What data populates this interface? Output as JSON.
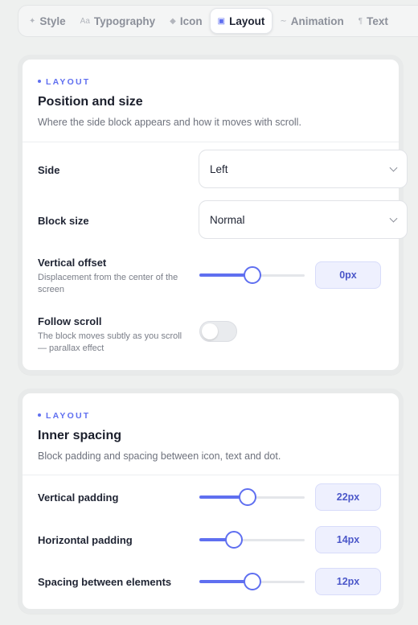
{
  "tabs": [
    {
      "label": "Style",
      "icon": "sparkle-icon",
      "glyph": "✦",
      "active": false
    },
    {
      "label": "Typography",
      "icon": "typography-icon",
      "glyph": "Aa",
      "active": false
    },
    {
      "label": "Icon",
      "icon": "diamond-icon",
      "glyph": "◆",
      "active": false
    },
    {
      "label": "Layout",
      "icon": "layout-icon",
      "glyph": "▣",
      "active": true
    },
    {
      "label": "Animation",
      "icon": "wave-icon",
      "glyph": "∼",
      "active": false
    },
    {
      "label": "Text",
      "icon": "paragraph-icon",
      "glyph": "¶",
      "active": false
    }
  ],
  "accent_color": "#5f6ff0",
  "position_card": {
    "eyebrow": "LAYOUT",
    "title": "Position and size",
    "subtitle": "Where the side block appears and how it moves with scroll.",
    "side": {
      "label": "Side",
      "value": "Left"
    },
    "block_size": {
      "label": "Block size",
      "value": "Normal"
    },
    "vertical_offset": {
      "label": "Vertical offset",
      "help": "Displacement from the center of the screen",
      "value": "0px",
      "fraction": 0.5
    },
    "follow_scroll": {
      "label": "Follow scroll",
      "help": "The block moves subtly as you scroll — parallax effect",
      "enabled": false
    }
  },
  "spacing_card": {
    "eyebrow": "LAYOUT",
    "title": "Inner spacing",
    "subtitle": "Block padding and spacing between icon, text and dot.",
    "vertical_padding": {
      "label": "Vertical padding",
      "value": "22px",
      "fraction": 0.46
    },
    "horizontal_padding": {
      "label": "Horizontal padding",
      "value": "14px",
      "fraction": 0.33
    },
    "element_spacing": {
      "label": "Spacing between elements",
      "value": "12px",
      "fraction": 0.5
    }
  }
}
